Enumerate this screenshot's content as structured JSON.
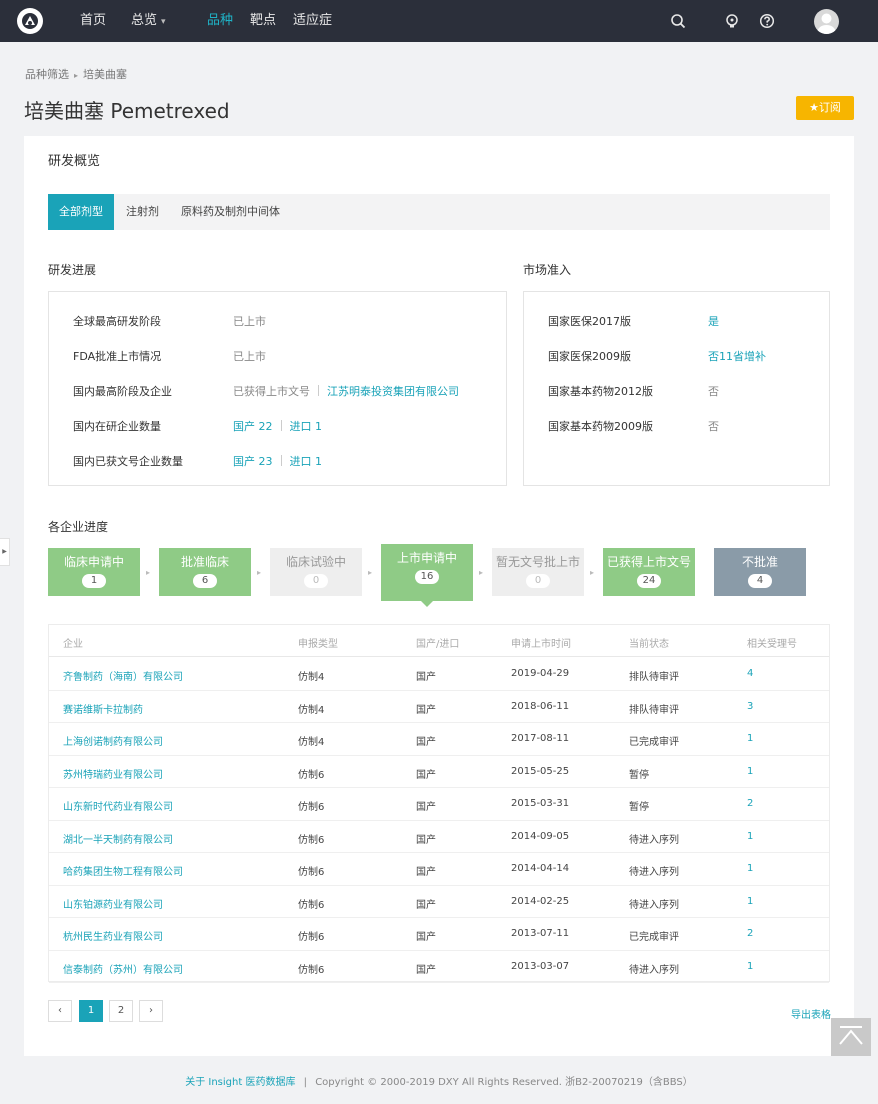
{
  "nav": {
    "items": [
      "首页",
      "总览",
      "品种",
      "靶点",
      "适应症"
    ],
    "active_index": 2,
    "icons": [
      "search-icon",
      "bulb-icon",
      "help-icon",
      "avatar-icon"
    ]
  },
  "breadcrumb": {
    "items": [
      "品种筛选",
      "培美曲塞"
    ]
  },
  "page_title": "培美曲塞 Pemetrexed",
  "subscribe_label": "订阅",
  "overview": {
    "title": "研发概览",
    "tabs": [
      "全部剂型",
      "注射剂",
      "原料药及制剂中间体"
    ],
    "active_tab": 0
  },
  "progress": {
    "title": "研发进展",
    "rows": [
      {
        "label": "全球最高研发阶段",
        "value": "已上市"
      },
      {
        "label": "FDA批准上市情况",
        "value": "已上市"
      },
      {
        "label": "国内最高阶段及企业",
        "value": "已获得上市文号",
        "link": "江苏明泰投资集团有限公司"
      },
      {
        "label": "国内在研企业数量",
        "domestic": "国产 22",
        "imported": "进口 1"
      },
      {
        "label": "国内已获文号企业数量",
        "domestic": "国产 23",
        "imported": "进口 1"
      }
    ]
  },
  "market": {
    "title": "市场准入",
    "rows": [
      {
        "label": "国家医保2017版",
        "value": "是"
      },
      {
        "label": "国家医保2009版",
        "value": "否11省增补"
      },
      {
        "label": "国家基本药物2012版",
        "value": "否"
      },
      {
        "label": "国家基本药物2009版",
        "value": "否"
      }
    ]
  },
  "pipeline": {
    "title": "各企业进度",
    "stages": [
      {
        "name": "临床申请中",
        "count": "1"
      },
      {
        "name": "批准临床",
        "count": "6"
      },
      {
        "name": "临床试验中",
        "count": "0"
      },
      {
        "name": "上市申请中",
        "count": "16"
      },
      {
        "name": "暂无文号批上市",
        "count": "0"
      },
      {
        "name": "已获得上市文号",
        "count": "24"
      },
      {
        "name": "不批准",
        "count": "4"
      }
    ],
    "active_stage": 3
  },
  "table": {
    "headers": [
      "企业",
      "申报类型",
      "国产/进口",
      "申请上市时间",
      "当前状态",
      "相关受理号"
    ],
    "rows": [
      [
        "齐鲁制药（海南）有限公司",
        "仿制4",
        "国产",
        "2019-04-29",
        "排队待审评",
        "4"
      ],
      [
        "赛诺维斯卡拉制药",
        "仿制4",
        "国产",
        "2018-06-11",
        "排队待审评",
        "3"
      ],
      [
        "上海创诺制药有限公司",
        "仿制4",
        "国产",
        "2017-08-11",
        "已完成审评",
        "1"
      ],
      [
        "苏州特瑞药业有限公司",
        "仿制6",
        "国产",
        "2015-05-25",
        "暂停",
        "1"
      ],
      [
        "山东新时代药业有限公司",
        "仿制6",
        "国产",
        "2015-03-31",
        "暂停",
        "2"
      ],
      [
        "湖北一半天制药有限公司",
        "仿制6",
        "国产",
        "2014-09-05",
        "待进入序列",
        "1"
      ],
      [
        "哈药集团生物工程有限公司",
        "仿制6",
        "国产",
        "2014-04-14",
        "待进入序列",
        "1"
      ],
      [
        "山东铂源药业有限公司",
        "仿制6",
        "国产",
        "2014-02-25",
        "待进入序列",
        "1"
      ],
      [
        "杭州民生药业有限公司",
        "仿制6",
        "国产",
        "2013-07-11",
        "已完成审评",
        "2"
      ],
      [
        "信泰制药（苏州）有限公司",
        "仿制6",
        "国产",
        "2013-03-07",
        "待进入序列",
        "1"
      ]
    ]
  },
  "pagination": {
    "prev": "‹",
    "pages": [
      "1",
      "2"
    ],
    "current": "1",
    "next": "›"
  },
  "export_label": "导出表格",
  "footer": {
    "link": "关于 Insight 医药数据库",
    "separator": "|",
    "text": "Copyright © 2000-2019 DXY All Rights Reserved. 浙B2-20070219（含BBS）"
  }
}
